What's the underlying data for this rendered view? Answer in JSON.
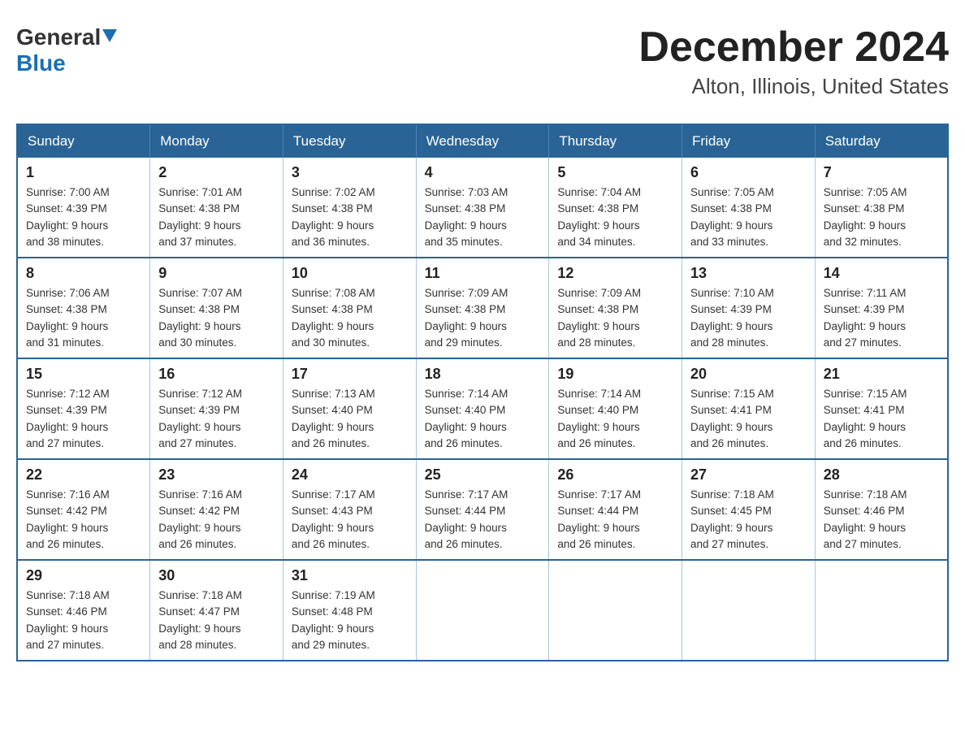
{
  "logo": {
    "general": "General",
    "blue": "Blue"
  },
  "title": {
    "month": "December 2024",
    "location": "Alton, Illinois, United States"
  },
  "weekdays": [
    "Sunday",
    "Monday",
    "Tuesday",
    "Wednesday",
    "Thursday",
    "Friday",
    "Saturday"
  ],
  "weeks": [
    [
      {
        "day": "1",
        "sunrise": "7:00 AM",
        "sunset": "4:39 PM",
        "daylight": "9 hours and 38 minutes."
      },
      {
        "day": "2",
        "sunrise": "7:01 AM",
        "sunset": "4:38 PM",
        "daylight": "9 hours and 37 minutes."
      },
      {
        "day": "3",
        "sunrise": "7:02 AM",
        "sunset": "4:38 PM",
        "daylight": "9 hours and 36 minutes."
      },
      {
        "day": "4",
        "sunrise": "7:03 AM",
        "sunset": "4:38 PM",
        "daylight": "9 hours and 35 minutes."
      },
      {
        "day": "5",
        "sunrise": "7:04 AM",
        "sunset": "4:38 PM",
        "daylight": "9 hours and 34 minutes."
      },
      {
        "day": "6",
        "sunrise": "7:05 AM",
        "sunset": "4:38 PM",
        "daylight": "9 hours and 33 minutes."
      },
      {
        "day": "7",
        "sunrise": "7:05 AM",
        "sunset": "4:38 PM",
        "daylight": "9 hours and 32 minutes."
      }
    ],
    [
      {
        "day": "8",
        "sunrise": "7:06 AM",
        "sunset": "4:38 PM",
        "daylight": "9 hours and 31 minutes."
      },
      {
        "day": "9",
        "sunrise": "7:07 AM",
        "sunset": "4:38 PM",
        "daylight": "9 hours and 30 minutes."
      },
      {
        "day": "10",
        "sunrise": "7:08 AM",
        "sunset": "4:38 PM",
        "daylight": "9 hours and 30 minutes."
      },
      {
        "day": "11",
        "sunrise": "7:09 AM",
        "sunset": "4:38 PM",
        "daylight": "9 hours and 29 minutes."
      },
      {
        "day": "12",
        "sunrise": "7:09 AM",
        "sunset": "4:38 PM",
        "daylight": "9 hours and 28 minutes."
      },
      {
        "day": "13",
        "sunrise": "7:10 AM",
        "sunset": "4:39 PM",
        "daylight": "9 hours and 28 minutes."
      },
      {
        "day": "14",
        "sunrise": "7:11 AM",
        "sunset": "4:39 PM",
        "daylight": "9 hours and 27 minutes."
      }
    ],
    [
      {
        "day": "15",
        "sunrise": "7:12 AM",
        "sunset": "4:39 PM",
        "daylight": "9 hours and 27 minutes."
      },
      {
        "day": "16",
        "sunrise": "7:12 AM",
        "sunset": "4:39 PM",
        "daylight": "9 hours and 27 minutes."
      },
      {
        "day": "17",
        "sunrise": "7:13 AM",
        "sunset": "4:40 PM",
        "daylight": "9 hours and 26 minutes."
      },
      {
        "day": "18",
        "sunrise": "7:14 AM",
        "sunset": "4:40 PM",
        "daylight": "9 hours and 26 minutes."
      },
      {
        "day": "19",
        "sunrise": "7:14 AM",
        "sunset": "4:40 PM",
        "daylight": "9 hours and 26 minutes."
      },
      {
        "day": "20",
        "sunrise": "7:15 AM",
        "sunset": "4:41 PM",
        "daylight": "9 hours and 26 minutes."
      },
      {
        "day": "21",
        "sunrise": "7:15 AM",
        "sunset": "4:41 PM",
        "daylight": "9 hours and 26 minutes."
      }
    ],
    [
      {
        "day": "22",
        "sunrise": "7:16 AM",
        "sunset": "4:42 PM",
        "daylight": "9 hours and 26 minutes."
      },
      {
        "day": "23",
        "sunrise": "7:16 AM",
        "sunset": "4:42 PM",
        "daylight": "9 hours and 26 minutes."
      },
      {
        "day": "24",
        "sunrise": "7:17 AM",
        "sunset": "4:43 PM",
        "daylight": "9 hours and 26 minutes."
      },
      {
        "day": "25",
        "sunrise": "7:17 AM",
        "sunset": "4:44 PM",
        "daylight": "9 hours and 26 minutes."
      },
      {
        "day": "26",
        "sunrise": "7:17 AM",
        "sunset": "4:44 PM",
        "daylight": "9 hours and 26 minutes."
      },
      {
        "day": "27",
        "sunrise": "7:18 AM",
        "sunset": "4:45 PM",
        "daylight": "9 hours and 27 minutes."
      },
      {
        "day": "28",
        "sunrise": "7:18 AM",
        "sunset": "4:46 PM",
        "daylight": "9 hours and 27 minutes."
      }
    ],
    [
      {
        "day": "29",
        "sunrise": "7:18 AM",
        "sunset": "4:46 PM",
        "daylight": "9 hours and 27 minutes."
      },
      {
        "day": "30",
        "sunrise": "7:18 AM",
        "sunset": "4:47 PM",
        "daylight": "9 hours and 28 minutes."
      },
      {
        "day": "31",
        "sunrise": "7:19 AM",
        "sunset": "4:48 PM",
        "daylight": "9 hours and 29 minutes."
      },
      null,
      null,
      null,
      null
    ]
  ],
  "labels": {
    "sunrise": "Sunrise:",
    "sunset": "Sunset:",
    "daylight": "Daylight:"
  }
}
